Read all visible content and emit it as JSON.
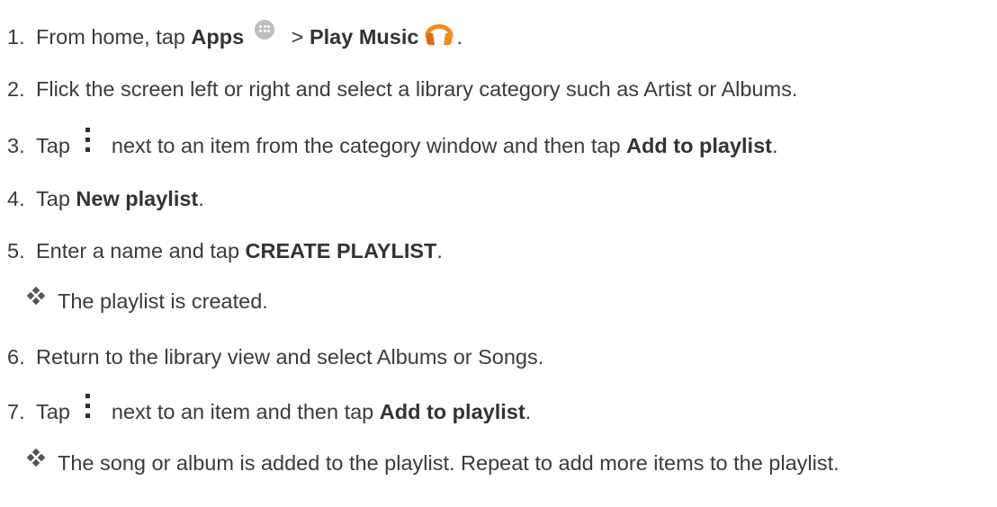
{
  "steps": [
    {
      "num": "1.",
      "t1": "From home, tap ",
      "b1": "Apps",
      "t2": " > ",
      "b2": "Play Music",
      "t3": "."
    },
    {
      "num": "2.",
      "t1": "Flick the screen left or right and select a library category such as Artist or Albums."
    },
    {
      "num": "3.",
      "t1": "Tap",
      "t2": "next to an item from the category window and then tap ",
      "b1": "Add to playlist",
      "t3": "."
    },
    {
      "num": "4.",
      "t1": "Tap ",
      "b1": "New playlist",
      "t2": "."
    },
    {
      "num": "5.",
      "t1": "Enter a name and tap ",
      "b1": "CREATE PLAYLIST",
      "t2": "."
    },
    {
      "num": "6.",
      "t1": "Return to the library view and select Albums or Songs."
    },
    {
      "num": "7.",
      "t1": "Tap",
      "t2": "next to an item and then tap ",
      "b1": "Add to playlist",
      "t3": "."
    }
  ],
  "results": [
    {
      "text": "The playlist is created."
    },
    {
      "text": "The song or album is added to the playlist. Repeat to add more items to the playlist."
    }
  ],
  "icons": {
    "apps": "apps-icon",
    "play_music": "headphones-icon",
    "menu": "more-vert-icon",
    "bullet": "diamond-bullet-icon"
  },
  "colors": {
    "text": "#3b3b3b",
    "play_music_orange": "#f28b1c",
    "play_music_dark": "#e06a12",
    "apps_gray": "#bdbdbd"
  }
}
